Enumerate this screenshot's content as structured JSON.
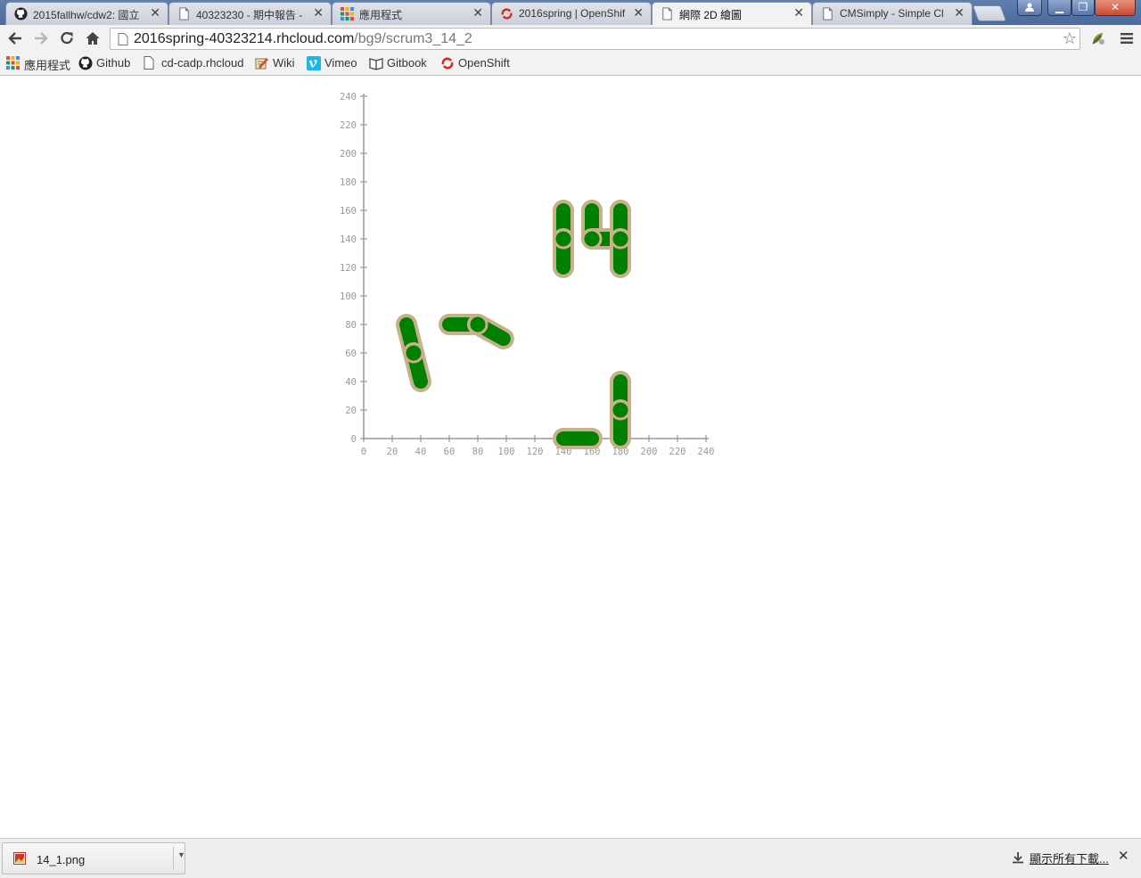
{
  "tabs": [
    {
      "title": "2015fallhw/cdw2: 國立",
      "icon": "github-icon",
      "active": false
    },
    {
      "title": "40323230 - 期中報告 -",
      "icon": "page-icon",
      "active": false
    },
    {
      "title": "應用程式",
      "icon": "apps-grid-icon",
      "active": false
    },
    {
      "title": "2016spring | OpenShif",
      "icon": "openshift-icon",
      "active": false
    },
    {
      "title": "網際 2D 繪圖",
      "icon": "page-icon",
      "active": true
    },
    {
      "title": "CMSimply - Simple Cl",
      "icon": "page-icon",
      "active": false
    }
  ],
  "toolbar": {
    "url_host": "2016spring-40323214.rhcloud.com",
    "url_path": "/bg9/scrum3_14_2"
  },
  "bookmarks": [
    {
      "label": "應用程式",
      "icon": "apps-grid-icon"
    },
    {
      "label": "Github",
      "icon": "github-icon"
    },
    {
      "label": "cd-cadp.rhcloud",
      "icon": "page-icon"
    },
    {
      "label": "Wiki",
      "icon": "wiki-icon"
    },
    {
      "label": "Vimeo",
      "icon": "vimeo-icon"
    },
    {
      "label": "Gitbook",
      "icon": "gitbook-icon"
    },
    {
      "label": "OpenShift",
      "icon": "openshift-icon"
    }
  ],
  "chart_data": {
    "type": "scatter",
    "x_ticks": [
      "0",
      "20",
      "40",
      "60",
      "80",
      "100",
      "120",
      "140",
      "160",
      "180",
      "200",
      "220",
      "240"
    ],
    "y_ticks": [
      "0",
      "20",
      "40",
      "60",
      "80",
      "100",
      "120",
      "140",
      "160",
      "180",
      "200",
      "220",
      "240"
    ],
    "xlim": [
      0,
      240
    ],
    "ylim": [
      0,
      240
    ],
    "grid": false,
    "link_fill": "#008000",
    "link_outline": "#c8b08a",
    "links": [
      {
        "x1": 140,
        "y1": 160,
        "x2": 140,
        "y2": 140
      },
      {
        "x1": 140,
        "y1": 140,
        "x2": 140,
        "y2": 120
      },
      {
        "x1": 160,
        "y1": 160,
        "x2": 160,
        "y2": 140
      },
      {
        "x1": 160,
        "y1": 140,
        "x2": 180,
        "y2": 140
      },
      {
        "x1": 180,
        "y1": 160,
        "x2": 180,
        "y2": 140
      },
      {
        "x1": 180,
        "y1": 140,
        "x2": 180,
        "y2": 120
      },
      {
        "x1": 30,
        "y1": 80,
        "x2": 35,
        "y2": 60
      },
      {
        "x1": 35,
        "y1": 60,
        "x2": 40,
        "y2": 40
      },
      {
        "x1": 60,
        "y1": 80,
        "x2": 80,
        "y2": 80
      },
      {
        "x1": 80,
        "y1": 80,
        "x2": 98,
        "y2": 70
      },
      {
        "x1": 180,
        "y1": 40,
        "x2": 180,
        "y2": 20
      },
      {
        "x1": 180,
        "y1": 20,
        "x2": 180,
        "y2": 0
      },
      {
        "x1": 140,
        "y1": 0,
        "x2": 160,
        "y2": 0
      }
    ],
    "joints": [
      {
        "x": 140,
        "y": 140
      },
      {
        "x": 160,
        "y": 140
      },
      {
        "x": 180,
        "y": 140
      },
      {
        "x": 35,
        "y": 60
      },
      {
        "x": 80,
        "y": 80
      },
      {
        "x": 180,
        "y": 20
      }
    ]
  },
  "downloads": {
    "file_name": "14_1.png",
    "show_all_label": "顯示所有下載..."
  }
}
